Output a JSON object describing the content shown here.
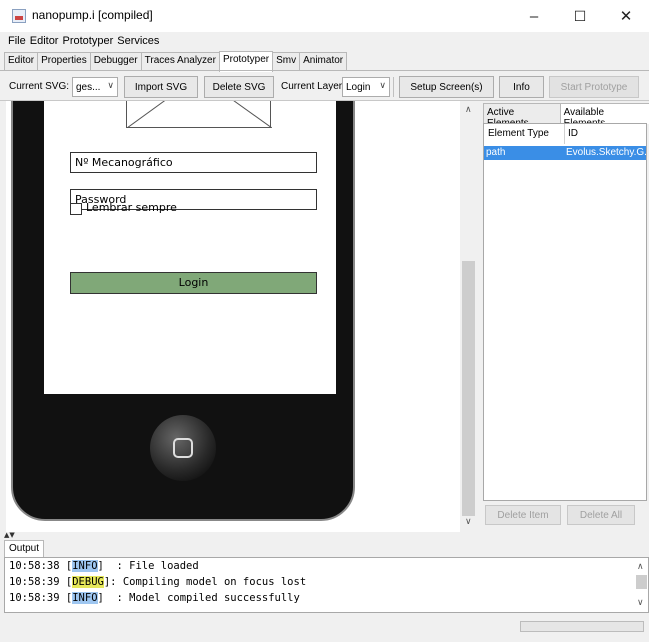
{
  "window": {
    "title": "nanopump.i [compiled]",
    "minimize": "–",
    "maximize": "☐",
    "close": "✕"
  },
  "menu": [
    "File",
    "Editor",
    "Prototyper",
    "Services"
  ],
  "tabs": [
    "Editor",
    "Properties",
    "Debugger",
    "Traces Analyzer",
    "Prototyper",
    "Smv",
    "Animator"
  ],
  "active_tab": "Prototyper",
  "toolbar": {
    "current_svg_label": "Current SVG:",
    "current_svg_value": "ges...",
    "import_svg": "Import SVG",
    "delete_svg": "Delete SVG",
    "current_layer_label": "Current Layer",
    "current_layer_value": "Login",
    "setup_screens": "Setup Screen(s)",
    "info": "Info",
    "start_prototype": "Start Prototype"
  },
  "prototype_screen": {
    "field_id": "Nº Mecanográfico",
    "field_password": "Password",
    "remember_label": "Lembrar sempre",
    "login_button": "Login"
  },
  "right_panel": {
    "tabs": [
      "Active Elements",
      "Available Elements"
    ],
    "active_tab": "Available Elements",
    "columns": [
      "Element Type",
      "ID"
    ],
    "rows": [
      {
        "type": "path",
        "id": "Evolus.Sketchy.G..."
      }
    ],
    "delete_item": "Delete Item",
    "delete_all": "Delete All"
  },
  "output": {
    "tab": "Output",
    "lines": [
      {
        "time": "10:58:38",
        "level": "INFO",
        "message": "  : File loaded"
      },
      {
        "time": "10:58:39",
        "level": "DEBUG",
        "message": ": Compiling model on focus lost"
      },
      {
        "time": "10:58:39",
        "level": "INFO",
        "message": "  : Model compiled successfully"
      }
    ]
  },
  "colors": {
    "selection": "#3a8ee6",
    "login_button": "#80a878",
    "info_highlight": "#9ec6f0",
    "debug_highlight": "#e6e85a"
  }
}
